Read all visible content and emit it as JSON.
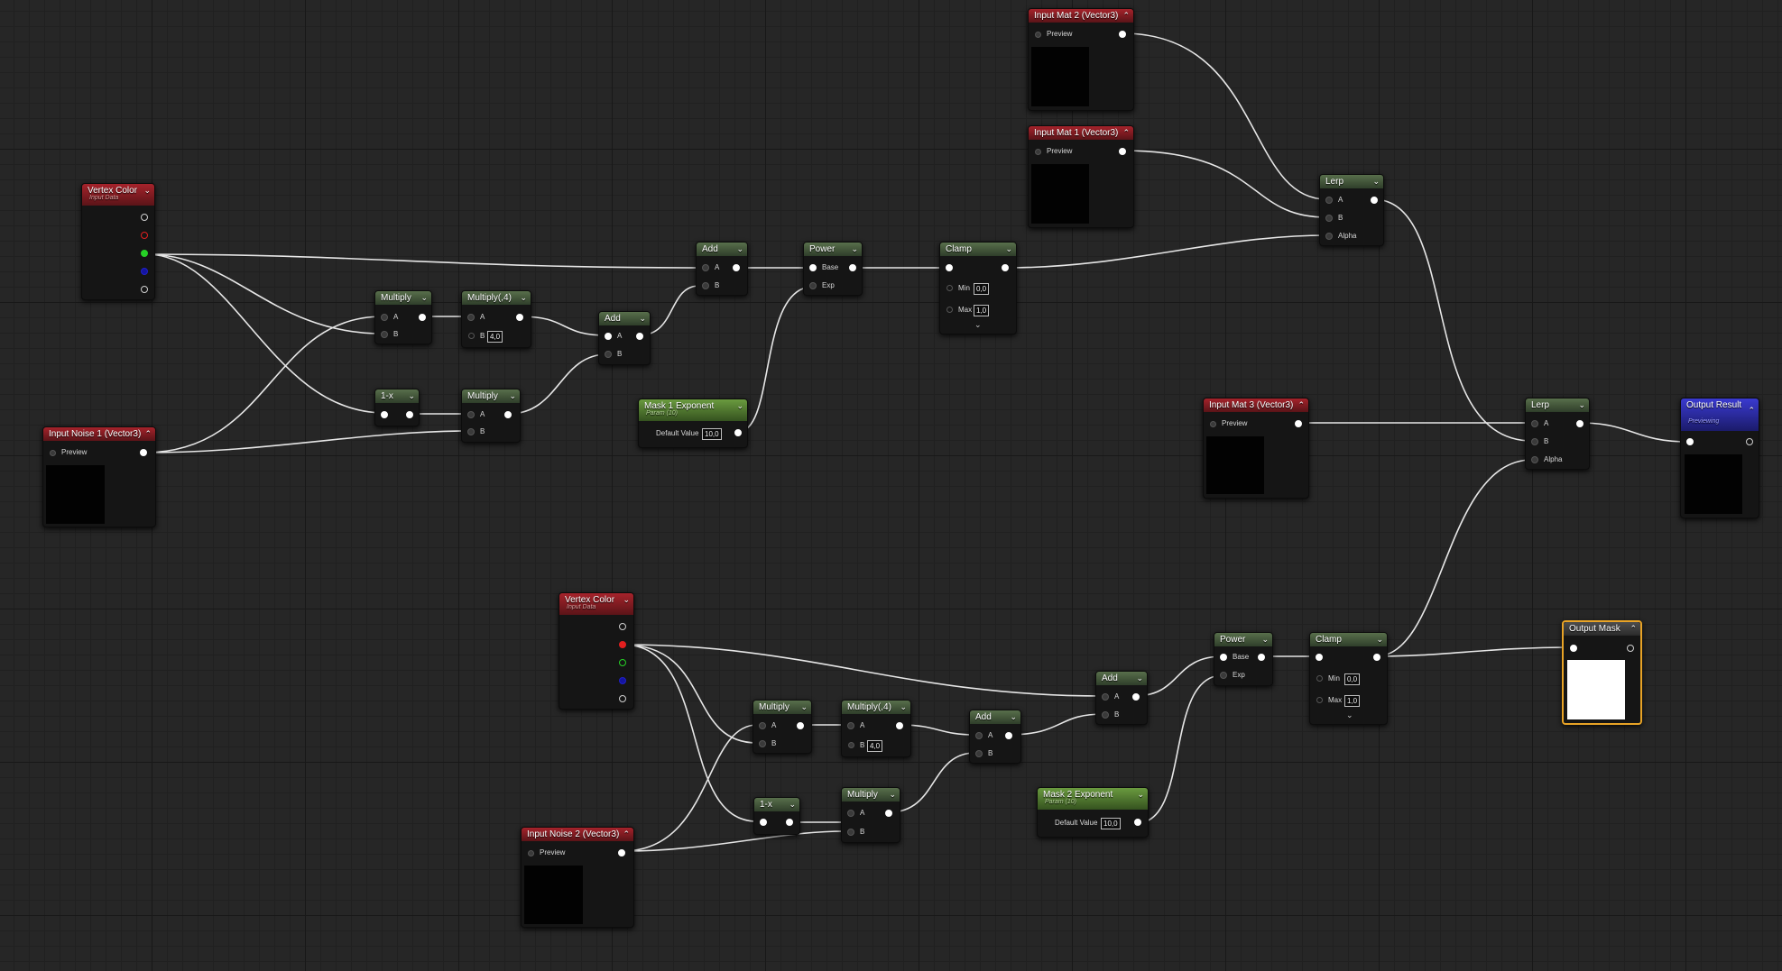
{
  "vertex_color_1": {
    "title": "Vertex Color",
    "subtitle": "Input Data"
  },
  "vertex_color_2": {
    "title": "Vertex Color",
    "subtitle": "Input Data"
  },
  "input_noise_1": {
    "title": "Input Noise 1 (Vector3)",
    "preview_label": "Preview"
  },
  "input_noise_2": {
    "title": "Input Noise 2 (Vector3)",
    "preview_label": "Preview"
  },
  "input_mat_1": {
    "title": "Input Mat 1 (Vector3)",
    "preview_label": "Preview"
  },
  "input_mat_2": {
    "title": "Input Mat 2 (Vector3)",
    "preview_label": "Preview"
  },
  "input_mat_3": {
    "title": "Input Mat 3 (Vector3)",
    "preview_label": "Preview"
  },
  "multiply_1": {
    "title": "Multiply",
    "a": "A",
    "b": "B"
  },
  "multiply4_1": {
    "title": "Multiply(,4)",
    "a": "A",
    "b": "B",
    "b_value": "4,0"
  },
  "oneminus_1": {
    "title": "1-x"
  },
  "multiply_2": {
    "title": "Multiply",
    "a": "A",
    "b": "B"
  },
  "add_1": {
    "title": "Add",
    "a": "A",
    "b": "B"
  },
  "add_2": {
    "title": "Add",
    "a": "A",
    "b": "B"
  },
  "power_1": {
    "title": "Power",
    "base": "Base",
    "exp": "Exp"
  },
  "mask1_exponent": {
    "title": "Mask 1 Exponent",
    "subtitle": "Param (10)",
    "default_label": "Default Value",
    "default_value": "10,0"
  },
  "clamp_1": {
    "title": "Clamp",
    "min_label": "Min",
    "min_value": "0,0",
    "max_label": "Max",
    "max_value": "1,0"
  },
  "lerp_1": {
    "title": "Lerp",
    "a": "A",
    "b": "B",
    "alpha": "Alpha"
  },
  "lerp_2": {
    "title": "Lerp",
    "a": "A",
    "b": "B",
    "alpha": "Alpha"
  },
  "output_result": {
    "title": "Output Result",
    "subtitle": "Previewing"
  },
  "multiply_3": {
    "title": "Multiply",
    "a": "A",
    "b": "B"
  },
  "multiply4_2": {
    "title": "Multiply(,4)",
    "a": "A",
    "b": "B",
    "b_value": "4,0"
  },
  "oneminus_2": {
    "title": "1-x"
  },
  "multiply_4": {
    "title": "Multiply",
    "a": "A",
    "b": "B"
  },
  "add_3": {
    "title": "Add",
    "a": "A",
    "b": "B"
  },
  "add_4": {
    "title": "Add",
    "a": "A",
    "b": "B"
  },
  "power_2": {
    "title": "Power",
    "base": "Base",
    "exp": "Exp"
  },
  "mask2_exponent": {
    "title": "Mask 2 Exponent",
    "subtitle": "Param (10)",
    "default_label": "Default Value",
    "default_value": "10,0"
  },
  "clamp_2": {
    "title": "Clamp",
    "min_label": "Min",
    "min_value": "0,0",
    "max_label": "Max",
    "max_value": "1,0"
  },
  "output_mask": {
    "title": "Output Mask"
  },
  "colors": {
    "red_header": "#a6232b",
    "green_header": "#586f4b",
    "param_header": "#6a9a3f",
    "output_header": "#3a3ad0",
    "selection": "#e8a326",
    "wire": "#e6e6e6"
  }
}
